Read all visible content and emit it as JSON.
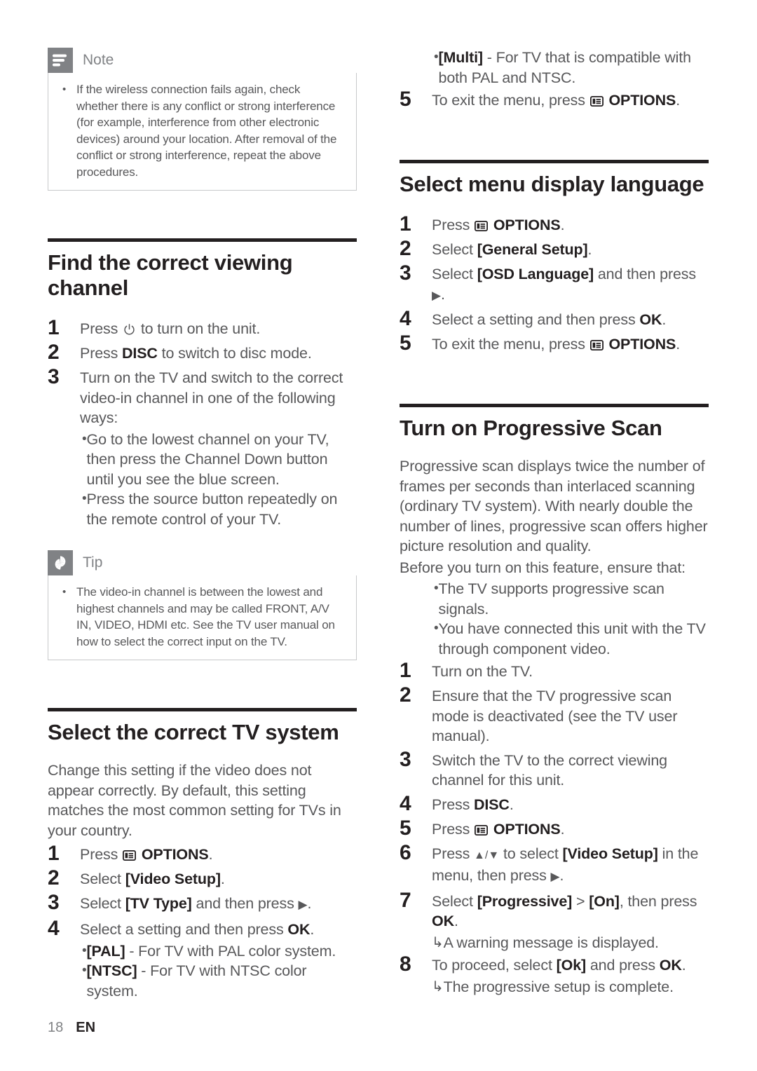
{
  "page": {
    "number": "18",
    "language": "EN"
  },
  "icons": {
    "note": "note-lines-icon",
    "tip": "tip-asterisk-icon",
    "options": "options-menu-icon",
    "power": "standby-power-icon",
    "arrow_right": "▶",
    "arrow_up_down": "▲/▼",
    "result_arrow": "↳",
    "bullet": "•"
  },
  "left_column": {
    "note": {
      "label": "Note",
      "bullets": [
        "If the wireless connection fails again, check whether there is any conflict or strong interference (for example, interference from other electronic devices) around your location. After removal of the conflict or strong interference, repeat the above procedures."
      ]
    },
    "section_find_channel": {
      "title": "Find the correct viewing channel",
      "steps": [
        {
          "num": "1",
          "parts": [
            {
              "t": "text",
              "v": "Press "
            },
            {
              "t": "icon",
              "v": "power"
            },
            {
              "t": "text",
              "v": " to turn on the unit."
            }
          ]
        },
        {
          "num": "2",
          "parts": [
            {
              "t": "text",
              "v": "Press "
            },
            {
              "t": "bold",
              "v": "DISC"
            },
            {
              "t": "text",
              "v": " to switch to disc mode."
            }
          ]
        },
        {
          "num": "3",
          "parts": [
            {
              "t": "text",
              "v": "Turn on the TV and switch to the correct video-in channel in one of the following ways:"
            }
          ],
          "bullets": [
            "Go to the lowest channel on your TV, then press the Channel Down button until you see the blue screen.",
            "Press the source button repeatedly on the remote control of your TV."
          ]
        }
      ]
    },
    "tip": {
      "label": "Tip",
      "bullets": [
        "The video-in channel is between the lowest and highest channels and may be called FRONT, A/V IN, VIDEO, HDMI etc. See the TV user manual on how to select the correct input on the TV."
      ]
    },
    "section_tv_system": {
      "title": "Select the correct TV system",
      "intro": "Change this setting if the video does not appear correctly. By default, this setting matches the most common setting for TVs in your country.",
      "steps": [
        {
          "num": "1",
          "parts": [
            {
              "t": "text",
              "v": "Press "
            },
            {
              "t": "icon",
              "v": "options"
            },
            {
              "t": "bold",
              "v": " OPTIONS"
            },
            {
              "t": "text",
              "v": "."
            }
          ]
        },
        {
          "num": "2",
          "parts": [
            {
              "t": "text",
              "v": "Select "
            },
            {
              "t": "bold",
              "v": "[Video Setup]"
            },
            {
              "t": "text",
              "v": "."
            }
          ]
        },
        {
          "num": "3",
          "parts": [
            {
              "t": "text",
              "v": "Select "
            },
            {
              "t": "bold",
              "v": "[TV Type]"
            },
            {
              "t": "text",
              "v": " and then press "
            },
            {
              "t": "icon",
              "v": "arrow_right"
            },
            {
              "t": "text",
              "v": "."
            }
          ]
        },
        {
          "num": "4",
          "parts": [
            {
              "t": "text",
              "v": "Select a setting and then press "
            },
            {
              "t": "bold",
              "v": "OK"
            },
            {
              "t": "text",
              "v": "."
            }
          ],
          "rich_bullets": [
            [
              {
                "t": "bold",
                "v": "[PAL]"
              },
              {
                "t": "text",
                "v": " - For TV with PAL color system."
              }
            ],
            [
              {
                "t": "bold",
                "v": "[NTSC]"
              },
              {
                "t": "text",
                "v": " - For TV with NTSC color system."
              }
            ]
          ]
        }
      ]
    }
  },
  "right_column": {
    "continued_bullets": [
      [
        {
          "t": "bold",
          "v": "[Multi]"
        },
        {
          "t": "text",
          "v": " - For TV that is compatible with both PAL and NTSC."
        }
      ]
    ],
    "continued_step": {
      "num": "5",
      "parts": [
        {
          "t": "text",
          "v": "To exit the menu, press "
        },
        {
          "t": "icon",
          "v": "options"
        },
        {
          "t": "bold",
          "v": " OPTIONS"
        },
        {
          "t": "text",
          "v": "."
        }
      ]
    },
    "section_menu_language": {
      "title": "Select menu display language",
      "steps": [
        {
          "num": "1",
          "parts": [
            {
              "t": "text",
              "v": "Press "
            },
            {
              "t": "icon",
              "v": "options"
            },
            {
              "t": "bold",
              "v": " OPTIONS"
            },
            {
              "t": "text",
              "v": "."
            }
          ]
        },
        {
          "num": "2",
          "parts": [
            {
              "t": "text",
              "v": "Select "
            },
            {
              "t": "bold",
              "v": "[General Setup]"
            },
            {
              "t": "text",
              "v": "."
            }
          ]
        },
        {
          "num": "3",
          "parts": [
            {
              "t": "text",
              "v": "Select "
            },
            {
              "t": "bold",
              "v": "[OSD Language]"
            },
            {
              "t": "text",
              "v": " and then press "
            },
            {
              "t": "icon",
              "v": "arrow_right"
            },
            {
              "t": "text",
              "v": "."
            }
          ]
        },
        {
          "num": "4",
          "parts": [
            {
              "t": "text",
              "v": "Select a setting and then press "
            },
            {
              "t": "bold",
              "v": "OK"
            },
            {
              "t": "text",
              "v": "."
            }
          ]
        },
        {
          "num": "5",
          "parts": [
            {
              "t": "text",
              "v": "To exit the menu, press "
            },
            {
              "t": "icon",
              "v": "options"
            },
            {
              "t": "bold",
              "v": " OPTIONS"
            },
            {
              "t": "text",
              "v": "."
            }
          ]
        }
      ]
    },
    "section_progressive_scan": {
      "title": "Turn on Progressive Scan",
      "intro": "Progressive scan displays twice the number of frames per seconds than interlaced scanning (ordinary TV system). With nearly double the number of lines, progressive scan offers higher picture resolution and quality.",
      "precondition_lead": "Before you turn on this feature, ensure that:",
      "precondition_bullets": [
        "The TV supports progressive scan signals.",
        "You have connected this unit with the TV through component video."
      ],
      "steps": [
        {
          "num": "1",
          "parts": [
            {
              "t": "text",
              "v": "Turn on the TV."
            }
          ]
        },
        {
          "num": "2",
          "parts": [
            {
              "t": "text",
              "v": "Ensure that the TV progressive scan mode is deactivated (see the TV user manual)."
            }
          ]
        },
        {
          "num": "3",
          "parts": [
            {
              "t": "text",
              "v": "Switch the TV to the correct viewing channel for this unit."
            }
          ]
        },
        {
          "num": "4",
          "parts": [
            {
              "t": "text",
              "v": "Press "
            },
            {
              "t": "bold",
              "v": "DISC"
            },
            {
              "t": "text",
              "v": "."
            }
          ]
        },
        {
          "num": "5",
          "parts": [
            {
              "t": "text",
              "v": "Press "
            },
            {
              "t": "icon",
              "v": "options"
            },
            {
              "t": "bold",
              "v": " OPTIONS"
            },
            {
              "t": "text",
              "v": "."
            }
          ]
        },
        {
          "num": "6",
          "parts": [
            {
              "t": "text",
              "v": "Press "
            },
            {
              "t": "icon",
              "v": "arrow_up_down"
            },
            {
              "t": "text",
              "v": " to select "
            },
            {
              "t": "bold",
              "v": "[Video Setup]"
            },
            {
              "t": "text",
              "v": " in the menu, then press "
            },
            {
              "t": "icon",
              "v": "arrow_right"
            },
            {
              "t": "text",
              "v": "."
            }
          ]
        },
        {
          "num": "7",
          "parts": [
            {
              "t": "text",
              "v": "Select "
            },
            {
              "t": "bold",
              "v": "[Progressive]"
            },
            {
              "t": "text",
              "v": " > "
            },
            {
              "t": "bold",
              "v": "[On]"
            },
            {
              "t": "text",
              "v": ", then press "
            },
            {
              "t": "bold",
              "v": "OK"
            },
            {
              "t": "text",
              "v": "."
            }
          ],
          "results": [
            "A warning message is displayed."
          ]
        },
        {
          "num": "8",
          "parts": [
            {
              "t": "text",
              "v": "To proceed, select "
            },
            {
              "t": "bold",
              "v": "[Ok]"
            },
            {
              "t": "text",
              "v": " and press "
            },
            {
              "t": "bold",
              "v": "OK"
            },
            {
              "t": "text",
              "v": "."
            }
          ],
          "results": [
            "The progressive setup is complete."
          ]
        }
      ]
    }
  },
  "colors": {
    "rule": "#231f20",
    "heading": "#231f20",
    "body": "#58585a",
    "callout_badge": "#808285",
    "callout_border": "#c7c8ca"
  }
}
